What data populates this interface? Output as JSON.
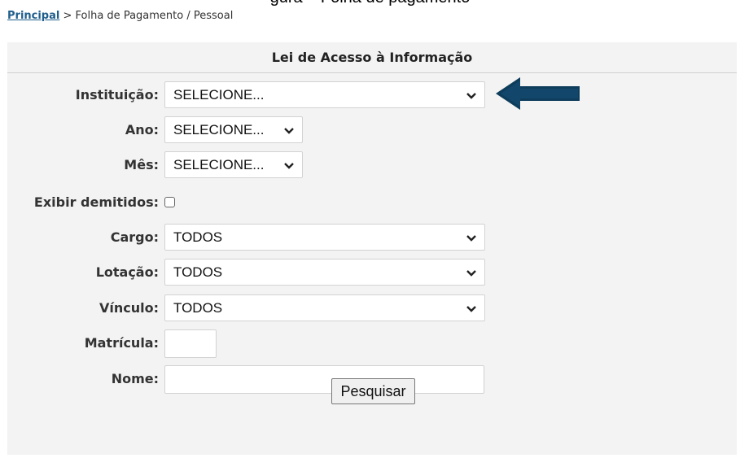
{
  "caption": {
    "text": "gura    Folha de pagamento"
  },
  "breadcrumb": {
    "home_label": "Principal",
    "trail": " > Folha de Pagamento / Pessoal"
  },
  "form": {
    "title": "Lei de Acesso à Informação",
    "instituicao": {
      "label": "Instituição:",
      "value": "SELECIONE..."
    },
    "ano": {
      "label": "Ano:",
      "value": "SELECIONE..."
    },
    "mes": {
      "label": "Mês:",
      "value": "SELECIONE..."
    },
    "exibir_demitidos": {
      "label": "Exibir demitidos:",
      "checked": false
    },
    "cargo": {
      "label": "Cargo:",
      "value": "TODOS"
    },
    "lotacao": {
      "label": "Lotação:",
      "value": "TODOS"
    },
    "vinculo": {
      "label": "Vínculo:",
      "value": "TODOS"
    },
    "matricula": {
      "label": "Matrícula:",
      "value": ""
    },
    "nome": {
      "label": "Nome:",
      "value": ""
    },
    "submit_label": "Pesquisar"
  },
  "annotation": {
    "arrow_icon": "left-arrow-icon",
    "arrow_color": "#0e3d5c"
  },
  "colors": {
    "panel_background": "#f3f3f3",
    "link": "#1f5e8c"
  }
}
